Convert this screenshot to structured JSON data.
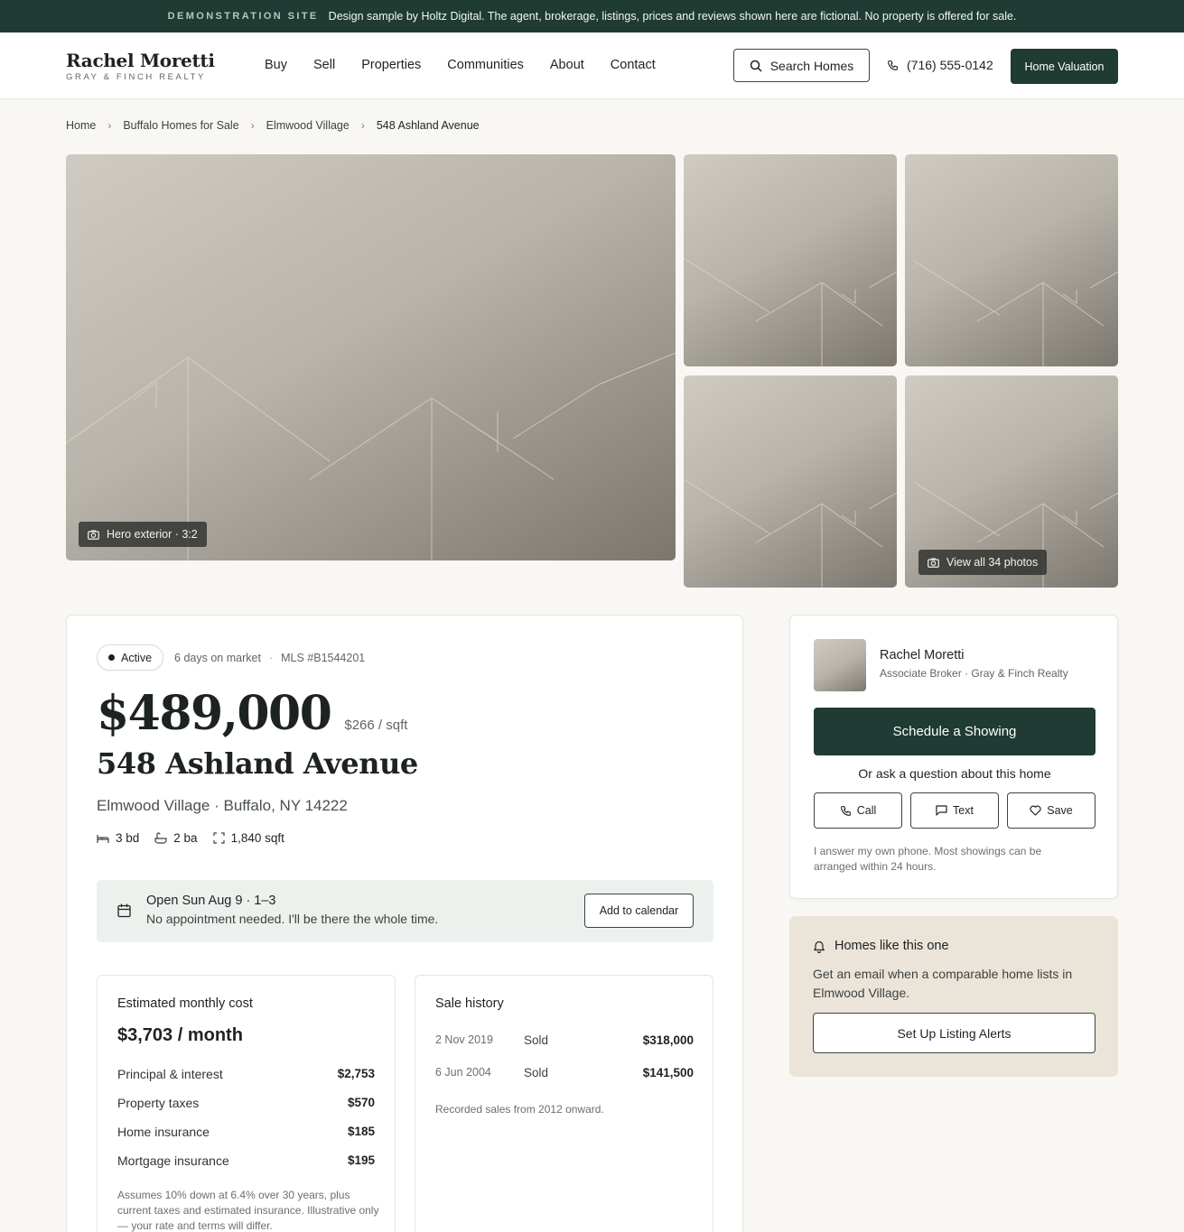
{
  "banner": {
    "tag": "DEMONSTRATION SITE",
    "text": "Design sample by Holtz Digital. The agent, brokerage, listings, prices and reviews shown here are fictional. No property is offered for sale."
  },
  "header": {
    "brand_name": "Rachel Moretti",
    "brand_sub": "GRAY & FINCH REALTY",
    "nav": [
      "Buy",
      "Sell",
      "Properties",
      "Communities",
      "About",
      "Contact"
    ],
    "search_label": "Search Homes",
    "phone": "(716) 555-0142",
    "valuation_label": "Home Valuation"
  },
  "breadcrumb": [
    "Home",
    "Buffalo Homes for Sale",
    "Elmwood Village",
    "548 Ashland Avenue"
  ],
  "gallery": {
    "hero_label": "Hero exterior · 3:2",
    "view_all_label": "View all 34 photos"
  },
  "listing": {
    "status": "Active",
    "days_on_market": "6 days on market",
    "mls": "MLS #B1544201",
    "price": "$489,000",
    "price_per_sqft": "$266 / sqft",
    "address": "548 Ashland Avenue",
    "locality": "Elmwood Village · Buffalo, NY 14222",
    "beds": "3 bd",
    "baths": "2 ba",
    "sqft": "1,840 sqft"
  },
  "open_house": {
    "title": "Open Sun Aug 9 · 1–3",
    "subtitle": "No appointment needed. I'll be there the whole time.",
    "calendar_label": "Add to calendar"
  },
  "monthly_cost": {
    "heading": "Estimated monthly cost",
    "total": "$3,703 / month",
    "items": [
      {
        "label": "Principal & interest",
        "amount": "$2,753"
      },
      {
        "label": "Property taxes",
        "amount": "$570"
      },
      {
        "label": "Home insurance",
        "amount": "$185"
      },
      {
        "label": "Mortgage insurance",
        "amount": "$195"
      }
    ],
    "note": "Assumes 10% down at 6.4% over 30 years, plus current taxes and estimated insurance. Illustrative only — your rate and terms will differ."
  },
  "sale_history": {
    "heading": "Sale history",
    "rows": [
      {
        "date": "2 Nov 2019",
        "event": "Sold",
        "amount": "$318,000"
      },
      {
        "date": "6 Jun 2004",
        "event": "Sold",
        "amount": "$141,500"
      }
    ],
    "note": "Recorded sales from 2012 onward."
  },
  "agent": {
    "name": "Rachel Moretti",
    "title": "Associate Broker · Gray & Finch Realty",
    "schedule_label": "Schedule a Showing",
    "ask_text": "Or ask a question about this home",
    "call_label": "Call",
    "text_label": "Text",
    "save_label": "Save",
    "note": "I answer my own phone. Most showings can be arranged within 24 hours."
  },
  "alerts": {
    "title": "Homes like this one",
    "description": "Get an email when a comparable home lists in Elmwood Village.",
    "button_label": "Set Up Listing Alerts"
  },
  "colors": {
    "brand_green": "#1f3b33",
    "page_bg": "#f8f7f4",
    "open_house_bg": "#edf1ee",
    "alerts_bg": "#ebe4d9"
  }
}
